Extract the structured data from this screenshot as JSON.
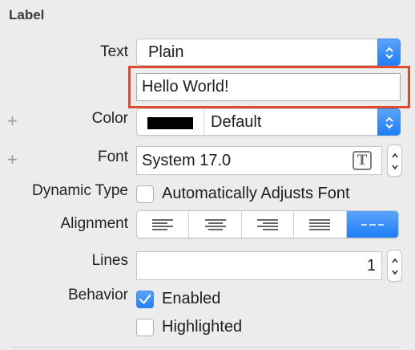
{
  "section": {
    "title": "Label"
  },
  "text_row": {
    "label": "Text",
    "mode_value": "Plain",
    "content_value": "Hello World!"
  },
  "color_row": {
    "label": "Color",
    "value": "Default",
    "swatch_color": "#000000"
  },
  "font_row": {
    "label": "Font",
    "value": "System 17.0",
    "font_button_glyph": "T"
  },
  "dynamic_type_row": {
    "label": "Dynamic Type",
    "checkbox_label": "Automatically Adjusts Font",
    "checked": false
  },
  "alignment_row": {
    "label": "Alignment",
    "options": [
      "left",
      "center",
      "right",
      "justified",
      "natural"
    ],
    "selected": "natural"
  },
  "lines_row": {
    "label": "Lines",
    "value": "1"
  },
  "behavior_row": {
    "label": "Behavior",
    "enabled_label": "Enabled",
    "enabled_checked": true,
    "highlighted_label": "Highlighted",
    "highlighted_checked": false
  },
  "colors": {
    "accent": "#1f7ef7",
    "highlight_border": "#e24a2f"
  },
  "icons": {
    "add": "plus-icon",
    "popup": "up-down-chevron-icon",
    "font_picker": "font-t-icon",
    "checkmark": "checkmark-icon"
  }
}
